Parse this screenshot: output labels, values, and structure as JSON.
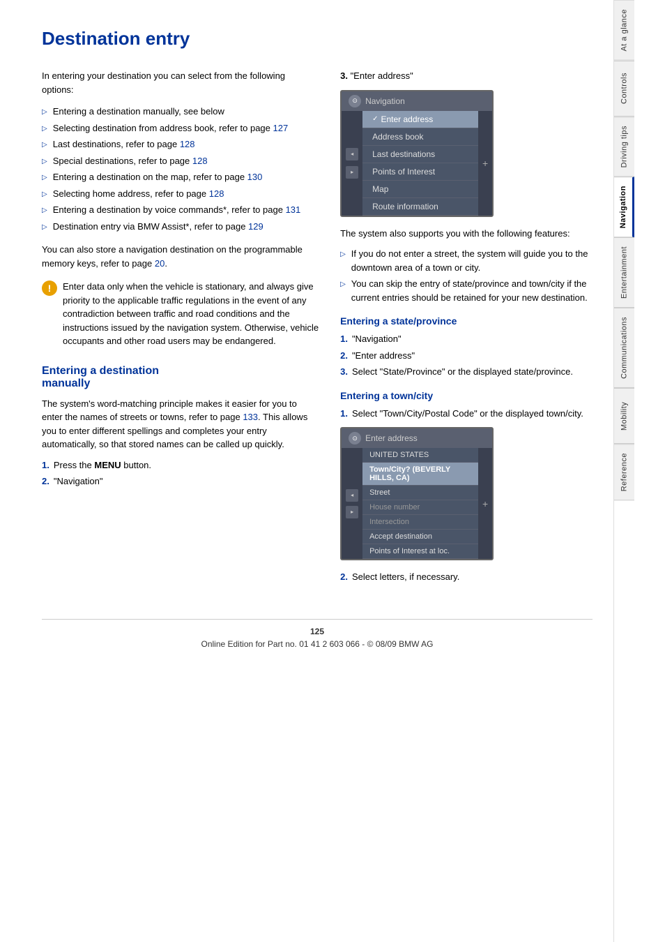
{
  "page": {
    "title": "Destination entry",
    "number": "125",
    "footer_text": "Online Edition for Part no. 01 41 2 603 066 - © 08/09 BMW AG"
  },
  "right_tabs": [
    {
      "id": "at-a-glance",
      "label": "At a glance",
      "active": false
    },
    {
      "id": "controls",
      "label": "Controls",
      "active": false
    },
    {
      "id": "driving-tips",
      "label": "Driving tips",
      "active": false
    },
    {
      "id": "navigation",
      "label": "Navigation",
      "active": true
    },
    {
      "id": "entertainment",
      "label": "Entertainment",
      "active": false
    },
    {
      "id": "communications",
      "label": "Communications",
      "active": false
    },
    {
      "id": "mobility",
      "label": "Mobility",
      "active": false
    },
    {
      "id": "reference",
      "label": "Reference",
      "active": false
    }
  ],
  "intro_text": "In entering your destination you can select from the following options:",
  "bullet_items": [
    {
      "text": "Entering a destination manually, see below",
      "link": null
    },
    {
      "text": "Selecting destination from address book, refer to page ",
      "link": "127"
    },
    {
      "text": "Last destinations, refer to page ",
      "link": "128"
    },
    {
      "text": "Special destinations, refer to page ",
      "link": "128"
    },
    {
      "text": "Entering a destination on the map, refer to page ",
      "link": "130"
    },
    {
      "text": "Selecting home address, refer to page ",
      "link": "128"
    },
    {
      "text": "Entering a destination by voice commands*, refer to page ",
      "link": "131"
    },
    {
      "text": "Destination entry via BMW Assist*, refer to page ",
      "link": "129"
    }
  ],
  "store_nav_text": "You can also store a navigation destination on the programmable memory keys, refer to page ",
  "store_nav_link": "20",
  "warning_text": "Enter data only when the vehicle is stationary, and always give priority to the applicable traffic regulations in the event of any contradiction between traffic and road conditions and the instructions issued by the navigation system. Otherwise, vehicle occupants and other road users may be endangered.",
  "section_entering_manually": {
    "title": "Entering a destination manually",
    "body": "The system's word-matching principle makes it easier for you to enter the names of streets or towns, refer to page 133. This allows you to enter different spellings and completes your entry automatically, so that stored names can be called up quickly.",
    "body_link": "133",
    "steps": [
      {
        "num": "1.",
        "text": "Press the ",
        "bold": "MENU",
        "after": " button."
      },
      {
        "num": "2.",
        "text": "\"Navigation\""
      }
    ]
  },
  "nav_screen": {
    "header_icon": "⊙",
    "header_title": "Navigation",
    "items": [
      {
        "label": "Enter address",
        "selected": true
      },
      {
        "label": "Address book",
        "selected": false
      },
      {
        "label": "Last destinations",
        "selected": false
      },
      {
        "label": "Points of Interest",
        "selected": false
      },
      {
        "label": "Map",
        "selected": false
      },
      {
        "label": "Route information",
        "selected": false
      }
    ]
  },
  "right_col": {
    "step3_label": "3.",
    "step3_text": "\"Enter address\"",
    "following_features_text": "The system also supports you with the following features:",
    "feature_bullets": [
      {
        "text": "If you do not enter a street, the system will guide you to the downtown area of a town or city."
      },
      {
        "text": "You can skip the entry of state/province and town/city if the current entries should be retained for your new destination."
      }
    ],
    "entering_state_section": {
      "title": "Entering a state/province",
      "steps": [
        {
          "num": "1.",
          "text": "\"Navigation\""
        },
        {
          "num": "2.",
          "text": "\"Enter address\""
        },
        {
          "num": "3.",
          "text": "Select \"State/Province\" or the displayed state/province."
        }
      ]
    },
    "entering_town_section": {
      "title": "Entering a town/city",
      "steps": [
        {
          "num": "1.",
          "text": "Select \"Town/City/Postal Code\" or the displayed town/city."
        }
      ]
    },
    "addr_screen": {
      "header_icon": "⊙",
      "header_title": "Enter address",
      "items": [
        {
          "label": "UNITED STATES",
          "style": "normal"
        },
        {
          "label": "Town/City? (BEVERLY HILLS, CA)",
          "style": "highlighted"
        },
        {
          "label": "Street",
          "style": "normal"
        },
        {
          "label": "House number",
          "style": "dimmed"
        },
        {
          "label": "Intersection",
          "style": "dimmed"
        },
        {
          "label": "Accept destination",
          "style": "normal"
        },
        {
          "label": "Points of Interest at loc.",
          "style": "normal"
        }
      ]
    },
    "step2_after_addr": "2.",
    "step2_after_addr_text": "Select letters, if necessary."
  }
}
